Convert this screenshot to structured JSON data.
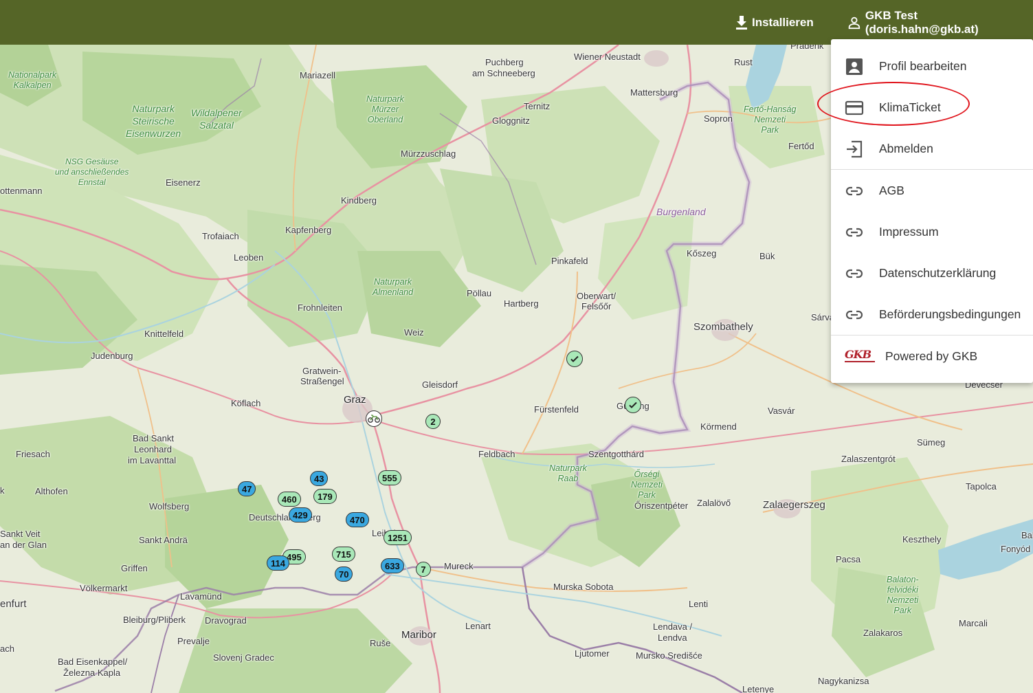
{
  "header": {
    "install_label": "Installieren",
    "user_label": "GKB Test (doris.hahn@gkb.at)"
  },
  "menu": {
    "items": [
      {
        "label": "Profil bearbeiten",
        "icon": "account-box-icon"
      },
      {
        "label": "KlimaTicket",
        "icon": "credit-card-icon"
      },
      {
        "label": "Abmelden",
        "icon": "logout-icon"
      },
      {
        "label": "AGB",
        "icon": "link-icon"
      },
      {
        "label": "Impressum",
        "icon": "link-icon"
      },
      {
        "label": "Datenschutzerklärung",
        "icon": "link-icon"
      },
      {
        "label": "Beförderungsbedingungen",
        "icon": "link-icon"
      },
      {
        "label": "Powered by GKB",
        "icon": "gkb-logo"
      }
    ],
    "logo_text": "GKB"
  },
  "map": {
    "places": {
      "wiener_neustadt": "Wiener Neustadt",
      "puchberg": "Puchberg",
      "am_schneeberg": "am Schneeberg",
      "mariazell": "Mariazell",
      "ternitz": "Ternitz",
      "gloggnitz": "Gloggnitz",
      "muerzzuschlag": "Mürzzuschlag",
      "rust": "Rust",
      "mattersburg": "Mattersburg",
      "sopron": "Sopron",
      "fertod": "Fertőd",
      "pradenk": "Pradenk",
      "eisenerz": "Eisenerz",
      "ottenmann": "ottenmann",
      "kindberg": "Kindberg",
      "kapfenberg": "Kapfenberg",
      "trofaiach": "Trofaiach",
      "leoben": "Leoben",
      "pinkafeld": "Pinkafeld",
      "koszeg": "Kőszeg",
      "buk": "Bük",
      "oberwart": "Oberwart/",
      "felsoor": "Felsőőr",
      "pollau": "Pöllau",
      "hartberg": "Hartberg",
      "frohnleiten": "Frohnleiten",
      "szombathely": "Szombathely",
      "sarva": "Sárva",
      "knittelfeld": "Knittelfeld",
      "judenburg": "Judenburg",
      "weiz": "Weiz",
      "gratwein": "Gratwein-",
      "strassengel": "Straßengel",
      "gleisdorf": "Gleisdorf",
      "graz": "Graz",
      "koflach": "Köflach",
      "furstenfeld": "Fürstenfeld",
      "gussing": "Güssing",
      "vasvar": "Vasvár",
      "kormend": "Körmend",
      "devecser": "Devecser",
      "bad_sankt": "Bad Sankt",
      "leonhard": "Leonhard",
      "im_lavanttal": "im Lavanttal",
      "friesach": "Friesach",
      "feldbach": "Feldbach",
      "szentgotthard": "Szentgotthárd",
      "sumeg": "Sümeg",
      "zalaszentgrot": "Zalaszentgrót",
      "althofen": "Althofen",
      "wolfsberg": "Wolfsberg",
      "deutschlandsberg": "Deutschlandsberg",
      "leibnitz": "Leibnitz",
      "oriszentpeter": "Őriszentpéter",
      "zalalovo": "Zalalövő",
      "zalaegerszeg": "Zalaegerszeg",
      "tapolca": "Tapolca",
      "sankt_veit": "Sankt Veit",
      "an_der_glan": "an der Glan",
      "sankt_andra": "Sankt Andrä",
      "keszthely": "Keszthely",
      "fonyod": "Fonyód",
      "bal": "Bal",
      "griffen": "Griffen",
      "volkermarkt": "Völkermarkt",
      "mureck": "Mureck",
      "pacsa": "Pacsa",
      "murska_sobota": "Murska Sobota",
      "lavamund": "Lavamünd",
      "enfurt": "enfurt",
      "lenti": "Lenti",
      "bleiburg": "Bleiburg/Pliberk",
      "dravograd": "Dravograd",
      "maribor": "Maribor",
      "lenart": "Lenart",
      "lendava": "Lendava /",
      "lendva": "Lendva",
      "marcali": "Marcali",
      "zalakaros": "Zalakaros",
      "prevalje": "Prevalje",
      "ruse": "Ruše",
      "ljutomer": "Ljutomer",
      "murska_sredisce": "Mursko Središće",
      "slovenj_gradec": "Slovenj Gradec",
      "bad_eisenkappel": "Bad Eisenkappel/",
      "zelezna_kapla": "Železna Kapla",
      "ach": "ach",
      "nagykanizsa": "Nagykanizsa",
      "letenye": "Letenye",
      "k_left": "k",
      "burgenland": "Burgenland"
    },
    "parks": {
      "kalkalpen_1": "Nationalpark",
      "kalkalpen_2": "Kalkalpen",
      "steirische_1": "Naturpark",
      "steirische_2": "Steirische",
      "steirische_3": "Eisenwurzen",
      "wildalpener_1": "Wildalpener",
      "wildalpener_2": "Salzatal",
      "murzer_1": "Naturpark",
      "murzer_2": "Mürzer",
      "murzer_3": "Oberland",
      "gesause_1": "NSG Gesäuse",
      "gesause_2": "und anschließendes",
      "gesause_3": "Ennstal",
      "ferto_1": "Fertő-Hanság",
      "ferto_2": "Nemzeti",
      "ferto_3": "Park",
      "almenland_1": "Naturpark",
      "almenland_2": "Almenland",
      "raab_1": "Naturpark",
      "raab_2": "Raab",
      "orseg_1": "Őrségi",
      "orseg_2": "Nemzeti",
      "orseg_3": "Park",
      "balaton_1": "Balaton-",
      "balaton_2": "felvidéki",
      "balaton_3": "Nemzeti",
      "balaton_4": "Park"
    },
    "markers": {
      "m2": "2",
      "m555": "555",
      "m43": "43",
      "m179": "179",
      "m47": "47",
      "m460": "460",
      "m429": "429",
      "m470": "470",
      "m1251": "1251",
      "m495": "495",
      "m715": "715",
      "m114": "114",
      "m70": "70",
      "m633": "633",
      "m7": "7"
    },
    "colors": {
      "cluster_blue": "#3aa8e0",
      "cluster_green": "#a9e8b8",
      "header": "#556527",
      "highlight": "#e0141c"
    }
  }
}
